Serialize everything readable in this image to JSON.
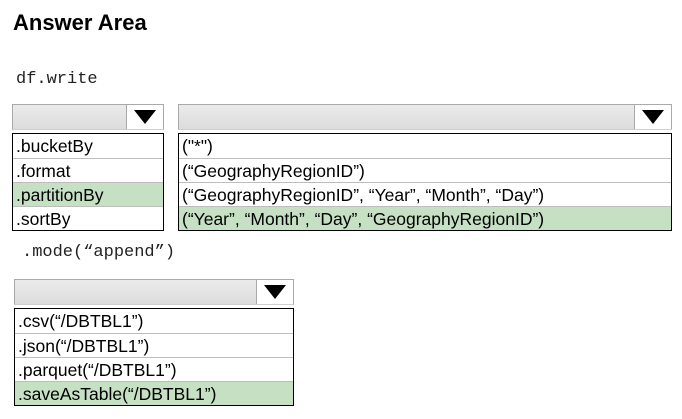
{
  "title": "Answer Area",
  "code": {
    "line1": "df.write",
    "line2": ".mode(“append”)"
  },
  "dropdown1": {
    "options": [
      ".bucketBy",
      ".format",
      ".partitionBy",
      ".sortBy"
    ],
    "selected_index": 2
  },
  "dropdown2": {
    "options": [
      "(\"*\")",
      "(“GeographyRegionID”)",
      "(“GeographyRegionID”, “Year”, “Month”, “Day”)",
      "(“Year”, “Month”, “Day”, “GeographyRegionID”)"
    ],
    "selected_index": 3
  },
  "dropdown3": {
    "options": [
      ".csv(“/DBTBL1”)",
      ".json(“/DBTBL1”)",
      ".parquet(“/DBTBL1”)",
      ".saveAsTable(“/DBTBL1”)"
    ],
    "selected_index": 3
  },
  "colors": {
    "selected_bg": "#c6e0c4",
    "header_bg": "#e3e3e3"
  },
  "icons": {
    "dropdown_arrow": "chevron-down-icon"
  }
}
